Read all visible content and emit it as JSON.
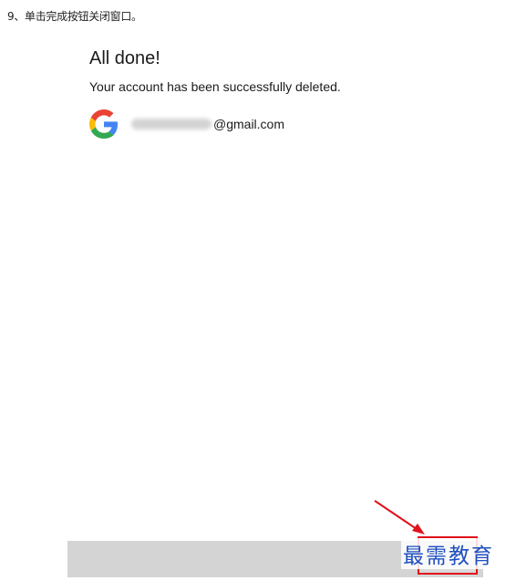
{
  "step_caption": "9、单击完成按钮关闭窗口。",
  "dialog": {
    "title": "All done!",
    "message": "Your account has been successfully deleted.",
    "account_email_domain": "@gmail.com",
    "account_icon": "google-g-icon"
  },
  "footer": {
    "done_button_label": ""
  },
  "watermark": "最需教育",
  "colors": {
    "annotation": "#e0121b",
    "watermark": "#1f4fc0",
    "footer": "#d4d4d4"
  }
}
